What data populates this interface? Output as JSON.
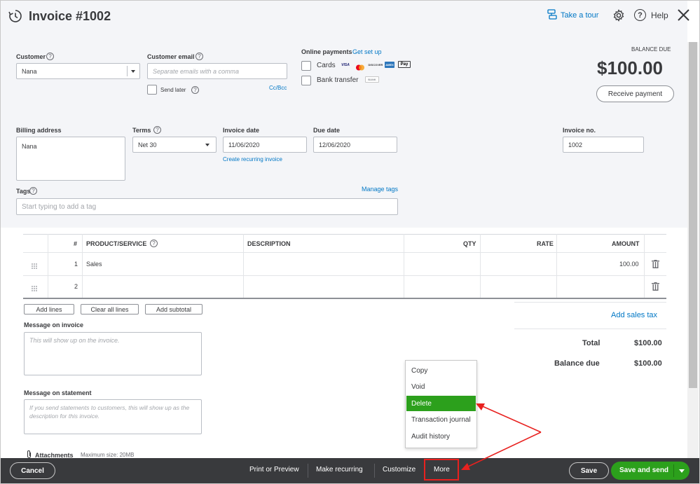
{
  "header": {
    "title": "Invoice #1002",
    "take_tour": "Take a tour",
    "help": "Help"
  },
  "customer": {
    "label": "Customer",
    "value": "Nana"
  },
  "email": {
    "label": "Customer email",
    "placeholder": "Separate emails with a comma",
    "send_later": "Send later",
    "cc_bcc": "Cc/Bcc"
  },
  "online_payments": {
    "label": "Online payments",
    "setup_link": "Get set up",
    "cards": "Cards",
    "bank_transfer": "Bank transfer",
    "card_logos": [
      "VISA",
      "MC",
      "DISCOVER",
      "AMEX",
      "Pay"
    ],
    "bank_logo": "BANK"
  },
  "balance": {
    "label": "BALANCE DUE",
    "amount": "$100.00",
    "receive_payment": "Receive payment"
  },
  "billing": {
    "label": "Billing address",
    "value": "Nana"
  },
  "terms": {
    "label": "Terms",
    "value": "Net 30"
  },
  "invoice_date": {
    "label": "Invoice date",
    "value": "11/06/2020",
    "recurring_link": "Create recurring invoice"
  },
  "due_date": {
    "label": "Due date",
    "value": "12/06/2020"
  },
  "invoice_no": {
    "label": "Invoice no.",
    "value": "1002"
  },
  "tags": {
    "label": "Tags",
    "manage": "Manage tags",
    "placeholder": "Start typing to add a tag"
  },
  "table": {
    "headers": [
      "#",
      "PRODUCT/SERVICE",
      "DESCRIPTION",
      "QTY",
      "RATE",
      "AMOUNT"
    ],
    "rows": [
      {
        "num": "1",
        "product": "Sales",
        "description": "",
        "qty": "",
        "rate": "",
        "amount": "100.00"
      },
      {
        "num": "2",
        "product": "",
        "description": "",
        "qty": "",
        "rate": "",
        "amount": ""
      }
    ]
  },
  "line_buttons": {
    "add_lines": "Add lines",
    "clear_all": "Clear all lines",
    "add_subtotal": "Add subtotal"
  },
  "message_invoice": {
    "label": "Message on invoice",
    "placeholder": "This will show up on the invoice."
  },
  "message_statement": {
    "label": "Message on statement",
    "placeholder": "If you send statements to customers, this will show up as the description for this invoice."
  },
  "attachments": {
    "label": "Attachments",
    "max_size": "Maximum size: 20MB"
  },
  "totals": {
    "add_sales_tax": "Add sales tax",
    "total_label": "Total",
    "total_value": "$100.00",
    "balance_label": "Balance due",
    "balance_value": "$100.00"
  },
  "more_menu": {
    "items": [
      "Copy",
      "Void",
      "Delete",
      "Transaction journal",
      "Audit history"
    ],
    "active_index": 2
  },
  "footer": {
    "cancel": "Cancel",
    "print_preview": "Print or Preview",
    "make_recurring": "Make recurring",
    "customize": "Customize",
    "more": "More",
    "save": "Save",
    "save_and_send": "Save and send"
  },
  "colors": {
    "brand_green": "#2ca01c",
    "link_blue": "#0077c5",
    "annotation_red": "#e8211f",
    "footer_bg": "#393a3d"
  }
}
